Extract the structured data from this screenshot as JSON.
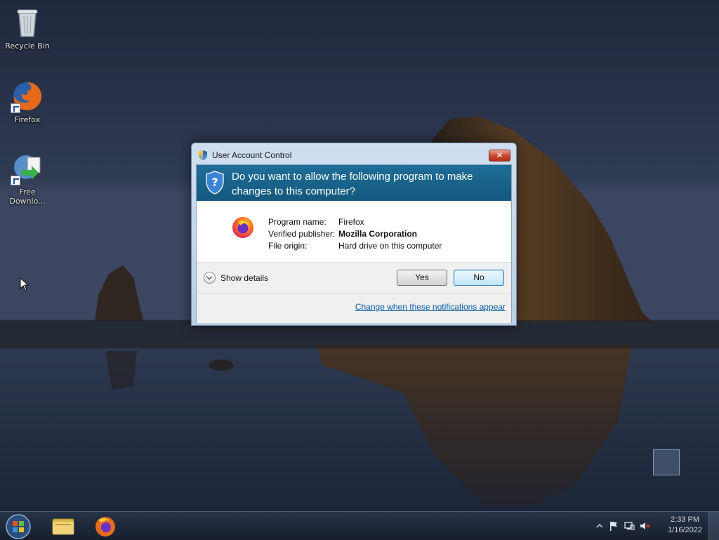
{
  "desktop": {
    "icons": [
      {
        "label": "Recycle Bin"
      },
      {
        "label": "Firefox"
      },
      {
        "label_line1": "Free",
        "label_line2": "Downlo..."
      }
    ]
  },
  "dialog": {
    "title": "User Account Control",
    "close_symbol": "✕",
    "question": "Do you want to allow the following program to make changes to this computer?",
    "program_name_key": "Program name:",
    "program_name_value": "Firefox",
    "publisher_key": "Verified publisher:",
    "publisher_value": "Mozilla Corporation",
    "origin_key": "File origin:",
    "origin_value": "Hard drive on this computer",
    "show_details": "Show details",
    "yes": "Yes",
    "no": "No",
    "change_link": "Change when these notifications appear"
  },
  "taskbar": {
    "time": "2:33 PM",
    "date": "1/16/2022",
    "pinned": [
      "file-explorer-icon",
      "firefox-icon"
    ]
  },
  "colors": {
    "uac_header": "#1e6e98",
    "link": "#0b5ea6"
  }
}
